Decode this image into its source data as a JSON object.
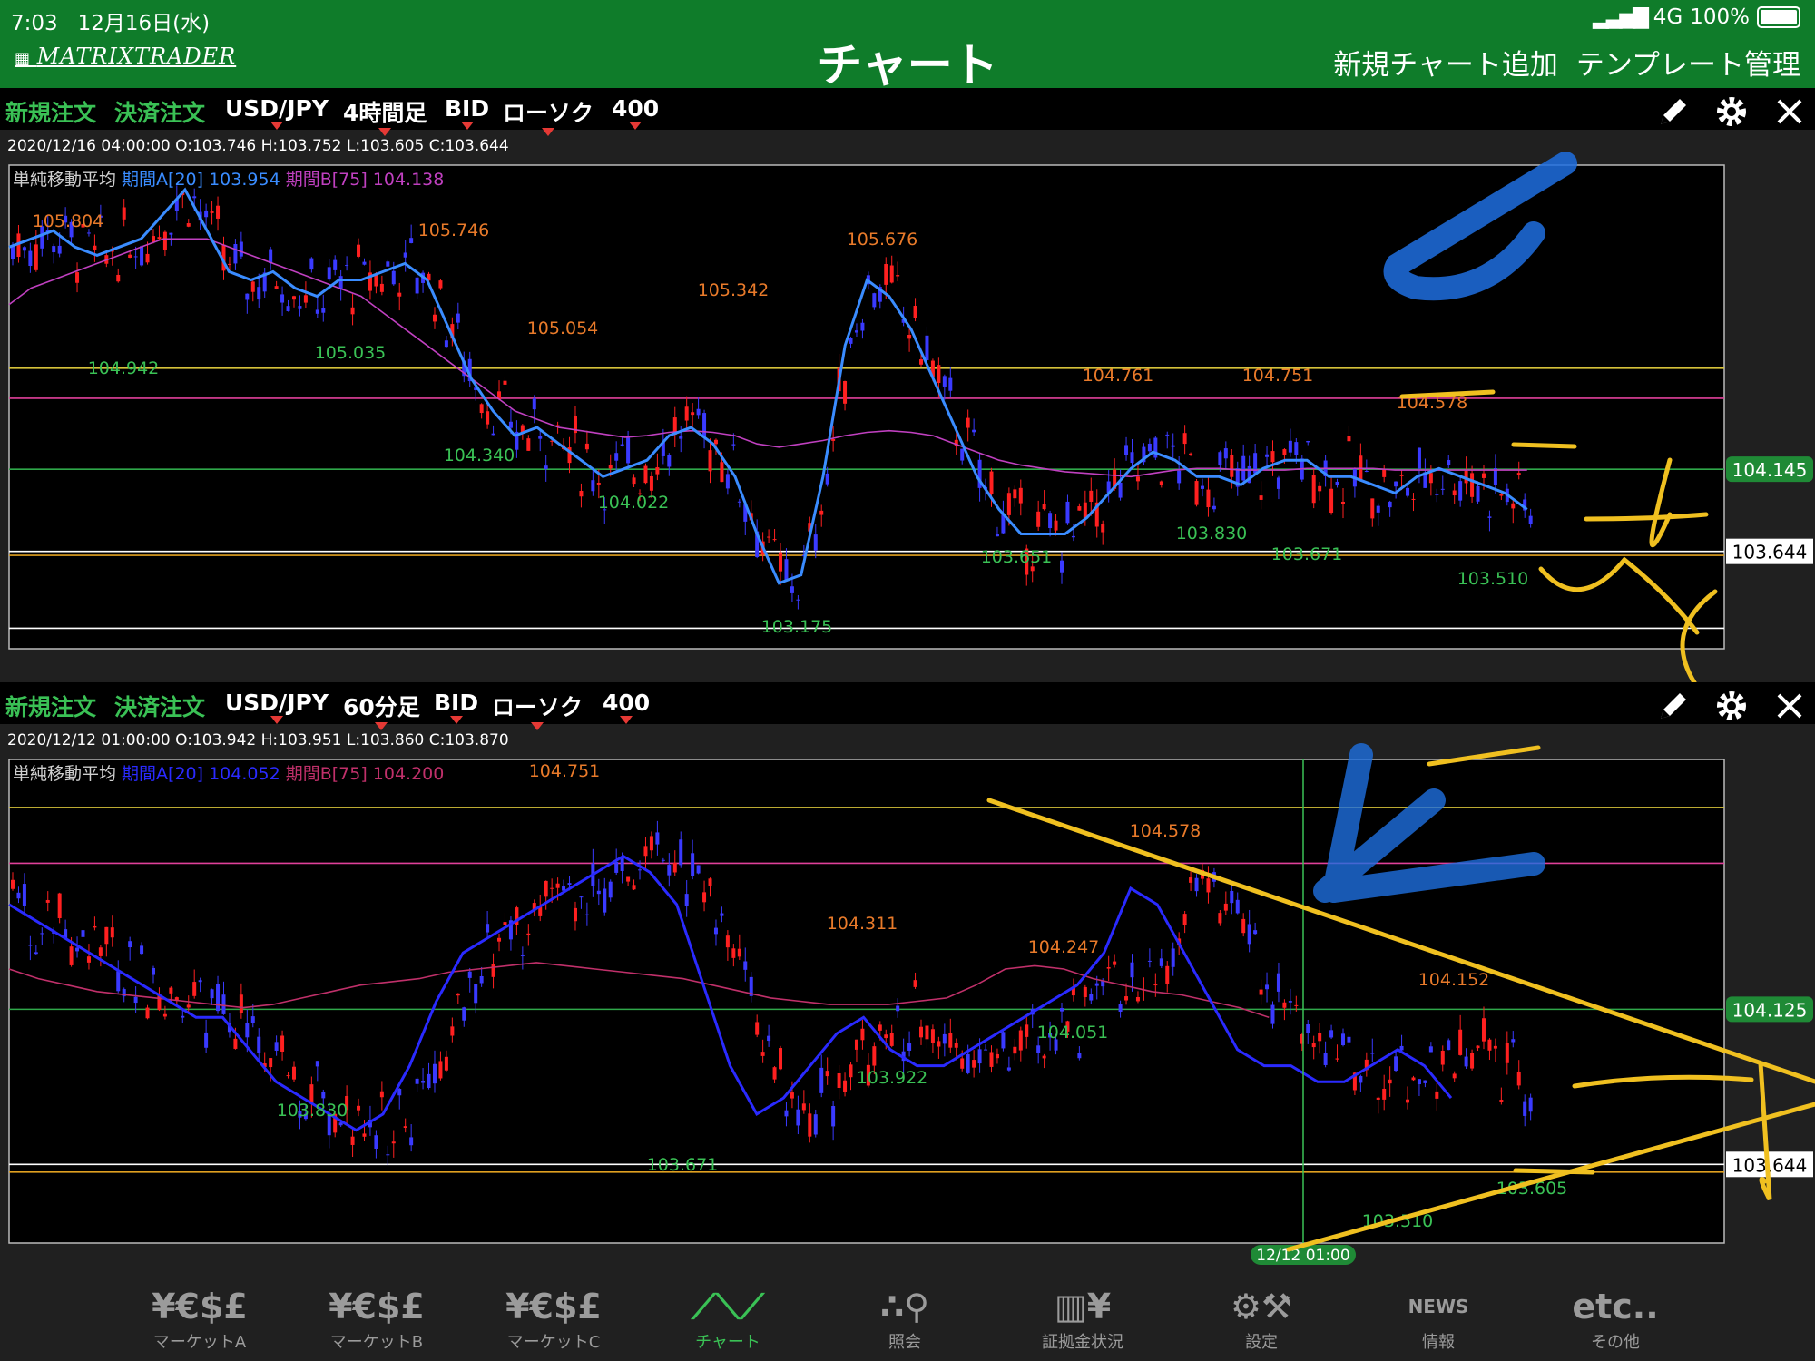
{
  "status_bar": {
    "time": "7:03",
    "date": "12月16日(水)",
    "signal": "4G",
    "battery": "100%"
  },
  "header": {
    "logo": "MATRIXTRADER",
    "title": "チャート",
    "add_chart": "新規チャート追加",
    "template": "テンプレート管理"
  },
  "panels": [
    {
      "new_order": "新規注文",
      "settle_order": "決済注文",
      "pair": "USD/JPY",
      "timeframe": "4時間足",
      "price_type": "BID",
      "chart_type": "ローソク",
      "count": "400",
      "ohlc": "2020/12/16 04:00:00   O:103.746  H:103.752  L:103.605  C:103.644",
      "indicator": {
        "name": "単純移動平均",
        "a": "期間A[20] 103.954",
        "b": "期間B[75] 104.138"
      },
      "axis_labels": {
        "green": "104.145",
        "white": "103.644"
      }
    },
    {
      "new_order": "新規注文",
      "settle_order": "決済注文",
      "pair": "USD/JPY",
      "timeframe": "60分足",
      "price_type": "BID",
      "chart_type": "ローソク",
      "count": "400",
      "ohlc": "2020/12/12 01:00:00   O:103.942  H:103.951  L:103.860  C:103.870",
      "indicator": {
        "name": "単純移動平均",
        "a": "期間A[20] 104.052",
        "b": "期間B[75] 104.200"
      },
      "axis_labels": {
        "green": "104.125",
        "white": "103.644"
      },
      "crosshair_time": "12/12 01:00"
    }
  ],
  "chart_data": [
    {
      "type": "candlestick",
      "pair": "USD/JPY",
      "timeframe": "4時間足",
      "ylim": [
        103.05,
        106.0
      ],
      "ma20": [
        105.5,
        105.55,
        105.6,
        105.5,
        105.45,
        105.5,
        105.55,
        105.7,
        105.85,
        105.6,
        105.35,
        105.3,
        105.35,
        105.25,
        105.2,
        105.3,
        105.3,
        105.35,
        105.4,
        105.3,
        105.0,
        104.7,
        104.5,
        104.35,
        104.4,
        104.3,
        104.2,
        104.1,
        104.15,
        104.2,
        104.35,
        104.4,
        104.3,
        104.1,
        103.75,
        103.45,
        103.5,
        104.1,
        104.9,
        105.3,
        105.2,
        105.0,
        104.7,
        104.4,
        104.1,
        103.9,
        103.75,
        103.75,
        103.75,
        103.85,
        104.0,
        104.15,
        104.25,
        104.2,
        104.1,
        104.1,
        104.05,
        104.15,
        104.2,
        104.2,
        104.1,
        104.1,
        104.05,
        104.0,
        104.1,
        104.15,
        104.1,
        104.05,
        104.0,
        103.9
      ],
      "ma75": [
        105.15,
        105.25,
        105.3,
        105.35,
        105.4,
        105.45,
        105.5,
        105.55,
        105.55,
        105.55,
        105.5,
        105.45,
        105.4,
        105.35,
        105.3,
        105.25,
        105.2,
        105.1,
        105.0,
        104.9,
        104.8,
        104.7,
        104.6,
        104.5,
        104.45,
        104.4,
        104.38,
        104.36,
        104.34,
        104.35,
        104.37,
        104.38,
        104.37,
        104.35,
        104.3,
        104.28,
        104.3,
        104.32,
        104.35,
        104.37,
        104.38,
        104.37,
        104.35,
        104.3,
        104.25,
        104.2,
        104.17,
        104.15,
        104.13,
        104.12,
        104.11,
        104.1,
        104.12,
        104.14,
        104.15,
        104.15,
        104.14,
        104.14,
        104.14,
        104.15,
        104.15,
        104.15,
        104.15,
        104.14,
        104.14,
        104.14,
        104.14,
        104.14,
        104.14,
        104.14
      ],
      "highs": [
        "105.804",
        "105.746",
        "105.054",
        "105.342",
        "105.676",
        "104.761",
        "104.751",
        "104.578"
      ],
      "lows": [
        "104.942",
        "105.035",
        "104.340",
        "104.022",
        "103.175",
        "103.651",
        "103.830",
        "103.671",
        "103.510"
      ],
      "hlines": [
        104.761,
        104.578,
        104.145,
        103.644,
        103.62,
        103.175
      ]
    },
    {
      "type": "candlestick",
      "pair": "USD/JPY",
      "timeframe": "60分足",
      "ylim": [
        103.4,
        104.9
      ],
      "ma20": [
        104.45,
        104.4,
        104.35,
        104.3,
        104.25,
        104.2,
        104.15,
        104.1,
        104.1,
        104.0,
        103.9,
        103.85,
        103.8,
        103.75,
        103.8,
        103.95,
        104.15,
        104.3,
        104.35,
        104.4,
        104.45,
        104.5,
        104.55,
        104.6,
        104.55,
        104.45,
        104.2,
        103.95,
        103.8,
        103.85,
        103.95,
        104.05,
        104.1,
        104.0,
        103.95,
        103.95,
        104.0,
        104.05,
        104.1,
        104.15,
        104.2,
        104.3,
        104.5,
        104.45,
        104.3,
        104.15,
        104.0,
        103.95,
        103.95,
        103.9,
        103.9,
        103.95,
        104.0,
        103.95,
        103.85
      ],
      "ma75": [
        104.25,
        104.22,
        104.2,
        104.18,
        104.17,
        104.16,
        104.15,
        104.14,
        104.13,
        104.14,
        104.16,
        104.18,
        104.2,
        104.21,
        104.22,
        104.24,
        104.25,
        104.26,
        104.27,
        104.26,
        104.25,
        104.24,
        104.23,
        104.22,
        104.2,
        104.18,
        104.16,
        104.15,
        104.14,
        104.14,
        104.14,
        104.15,
        104.16,
        104.2,
        104.25,
        104.26,
        104.25,
        104.22,
        104.2,
        104.18,
        104.17,
        104.15,
        104.13,
        104.1
      ],
      "highs": [
        "104.751",
        "104.578",
        "104.311",
        "104.247",
        "104.152"
      ],
      "lows": [
        "103.830",
        "103.671",
        "103.922",
        "104.051",
        "103.510",
        "103.605"
      ],
      "hlines": [
        104.751,
        104.578,
        104.125,
        103.644,
        103.62
      ]
    }
  ],
  "tabs": [
    {
      "icon": "¥€$£",
      "label": "マーケットA"
    },
    {
      "icon": "¥€$£",
      "label": "マーケットB"
    },
    {
      "icon": "¥€$£",
      "label": "マーケットC"
    },
    {
      "icon": "chart",
      "label": "チャート"
    },
    {
      "icon": "search",
      "label": "照会"
    },
    {
      "icon": "¥",
      "label": "証拠金状況"
    },
    {
      "icon": "gear",
      "label": "設定"
    },
    {
      "icon": "NEWS",
      "label": "情報"
    },
    {
      "icon": "etc..",
      "label": "その他"
    }
  ]
}
